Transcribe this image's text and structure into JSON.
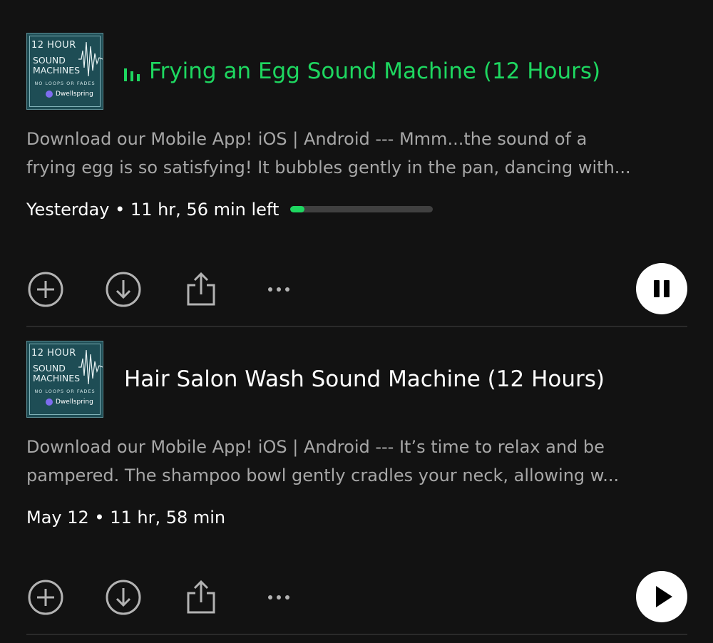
{
  "episodes": [
    {
      "art": {
        "line1": "12 HOUR",
        "line2a": "SOUND",
        "line2b": "MACHINES",
        "line3": "NO LOOPS OR FADES",
        "brand": "Dwellspring"
      },
      "title": "Frying an Egg Sound Machine (12 Hours)",
      "now_playing": true,
      "description_line1": "Download our Mobile App! iOS | Android --- Mmm...the sound of a",
      "description_line2": "frying egg is so satisfying! It bubbles gently in the pan, dancing with...",
      "meta": "Yesterday • 11 hr, 56 min left",
      "progress_fraction": 0.1,
      "state": "pause",
      "icons": [
        "add-icon",
        "download-icon",
        "share-icon",
        "more-icon",
        "pause-icon",
        "equalizer-icon"
      ]
    },
    {
      "art": {
        "line1": "12 HOUR",
        "line2a": "SOUND",
        "line2b": "MACHINES",
        "line3": "NO LOOPS OR FADES",
        "brand": "Dwellspring"
      },
      "title": "Hair Salon Wash Sound Machine (12 Hours)",
      "now_playing": false,
      "description_line1": "Download our Mobile App!  iOS | Android  ---  It’s time to relax and be",
      "description_line2": "pampered. The shampoo bowl gently cradles your neck, allowing w...",
      "meta": "May 12 • 11 hr, 58 min",
      "state": "play",
      "icons": [
        "add-icon",
        "download-icon",
        "share-icon",
        "more-icon",
        "play-icon"
      ]
    }
  ],
  "colors": {
    "background": "#121212",
    "accent": "#1ed760",
    "secondary_text": "#a7a7a7",
    "art_bg": "#1e4d55"
  }
}
